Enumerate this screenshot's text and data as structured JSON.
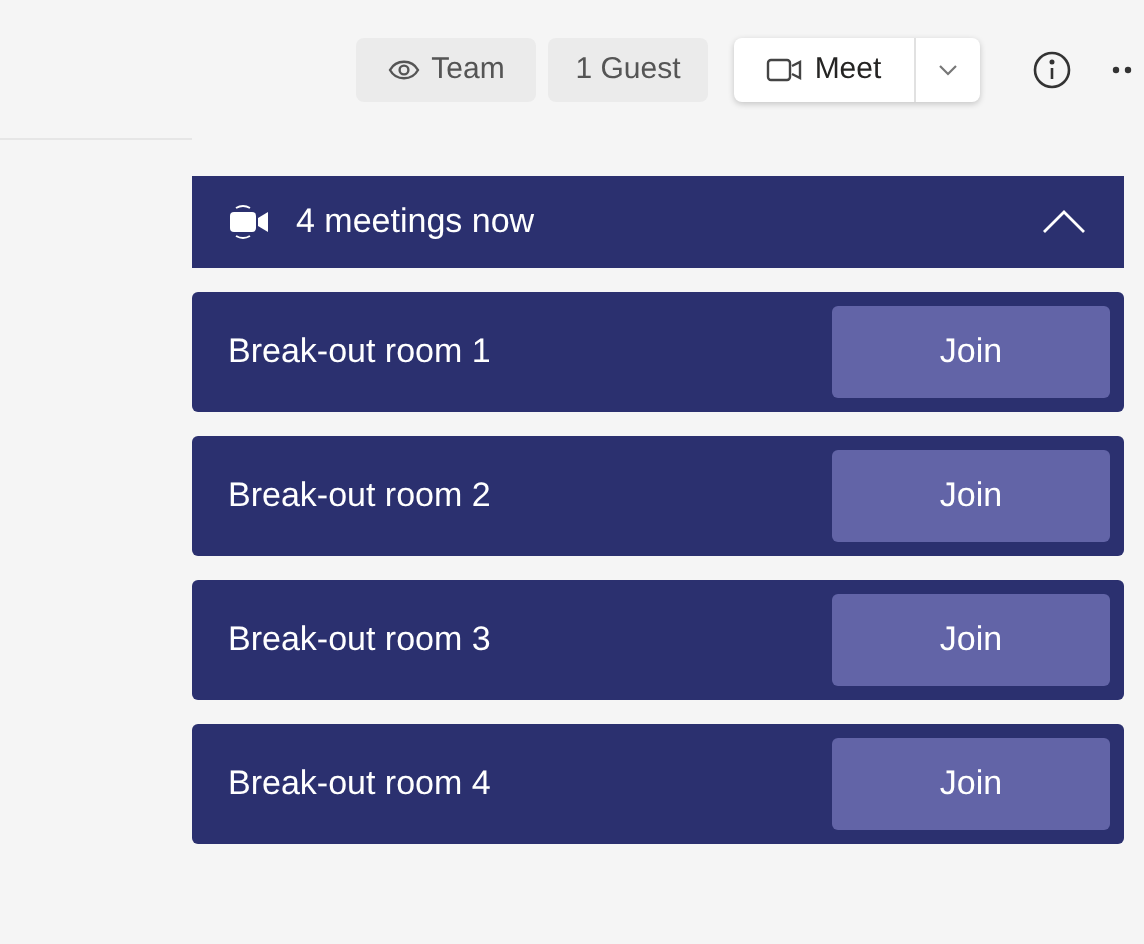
{
  "header": {
    "team_button": "Team",
    "guest_button": "1 Guest",
    "meet_button": "Meet"
  },
  "meetings": {
    "title": "4 meetings now",
    "expanded": true,
    "rooms": [
      {
        "name": "Break-out room 1",
        "action": "Join"
      },
      {
        "name": "Break-out room 2",
        "action": "Join"
      },
      {
        "name": "Break-out room 3",
        "action": "Join"
      },
      {
        "name": "Break-out room 4",
        "action": "Join"
      }
    ]
  }
}
